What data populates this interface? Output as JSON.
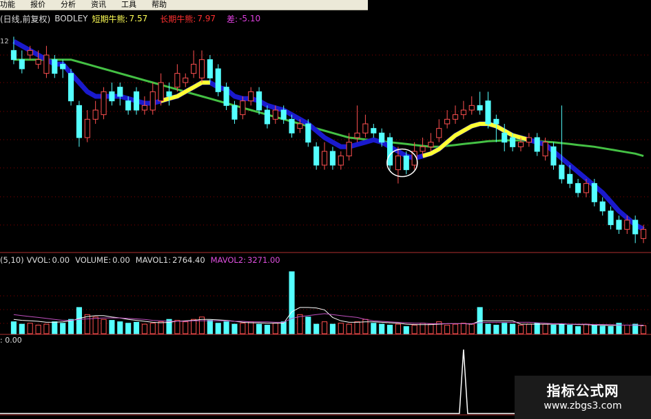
{
  "menu": [
    "功能",
    "报价",
    "分析",
    "资讯",
    "工具",
    "帮助"
  ],
  "main_header": {
    "period": "(日线,前复权)",
    "indicator": "BODLEY",
    "short_label": "短期牛熊:",
    "short_value": "7.57",
    "long_label": "长期牛熊:",
    "long_value": "7.97",
    "diff_label": "差:",
    "diff_value": "-5.10",
    "left_label": "12"
  },
  "volume_header": {
    "name": "(5,10)",
    "vvol_label": "VVOL:",
    "vvol_value": "0.00",
    "volume_label": "VOLUME:",
    "volume_value": "0.00",
    "mavol1_label": "MAVOL1:",
    "mavol1_value": "2764.40",
    "mavol2_label": "MAVOL2:",
    "mavol2_value": "3271.00"
  },
  "indicator_header": {
    "value": ": 0.00"
  },
  "colors": {
    "up": "#ff5050",
    "down": "#54ffff",
    "short_line": "#1a1acd",
    "long_line": "#44c044",
    "highlight": "#ffff33",
    "mavol1": "#ffffff",
    "mavol2": "#c050c0",
    "grid": "#8b0000"
  },
  "watermark": {
    "title": "指标公式网",
    "url": "www.zbgs3.com"
  },
  "chart_data": {
    "type": "candlestick",
    "open": [
      9.8,
      9.6,
      9.7,
      9.5,
      9.3,
      9.6,
      9.5,
      9.3,
      8.6,
      7.9,
      8.3,
      8.4,
      8.9,
      9.0,
      8.7,
      8.9,
      8.5,
      8.5,
      8.7,
      8.9,
      9.0,
      9.1,
      9.3,
      9.2,
      9.6,
      9.4,
      9.0,
      8.6,
      8.4,
      8.7,
      8.9,
      8.5,
      8.3,
      8.5,
      8.3,
      8.1,
      8.2,
      7.7,
      7.3,
      7.6,
      7.3,
      7.5,
      7.9,
      8.0,
      8.1,
      8.0,
      7.9,
      7.2,
      7.5,
      7.3,
      7.6,
      7.7,
      7.9,
      8.2,
      8.3,
      8.4,
      8.5,
      8.6,
      8.7,
      8.3,
      8.0,
      7.9,
      7.7,
      7.8,
      7.9,
      7.5,
      7.7,
      7.3,
      7.1,
      6.9,
      6.7,
      6.9,
      6.5,
      6.3,
      6.1,
      5.9,
      6.1,
      5.7
    ],
    "close": [
      9.6,
      9.4,
      9.8,
      9.6,
      9.7,
      9.3,
      9.4,
      8.7,
      7.9,
      8.3,
      8.5,
      8.9,
      8.7,
      8.8,
      8.5,
      8.5,
      8.6,
      8.9,
      9.1,
      8.8,
      9.3,
      9.2,
      9.5,
      9.6,
      9.2,
      8.9,
      8.6,
      8.3,
      8.7,
      8.9,
      8.5,
      8.2,
      8.5,
      8.3,
      8.0,
      8.2,
      7.8,
      7.3,
      7.6,
      7.3,
      7.5,
      7.8,
      8.0,
      8.2,
      8.0,
      7.8,
      7.3,
      7.5,
      7.2,
      7.6,
      7.7,
      7.8,
      8.1,
      8.3,
      8.4,
      8.5,
      8.6,
      8.5,
      8.2,
      8.2,
      7.8,
      7.7,
      7.8,
      7.9,
      7.6,
      7.8,
      7.3,
      7.0,
      6.9,
      6.7,
      6.9,
      6.5,
      6.3,
      6.0,
      5.9,
      6.1,
      5.8,
      5.9
    ],
    "high": [
      10.1,
      9.8,
      9.9,
      9.8,
      9.9,
      9.7,
      9.6,
      9.4,
      8.7,
      8.5,
      8.7,
      9.0,
      9.1,
      9.1,
      8.8,
      9.0,
      8.8,
      9.1,
      9.3,
      9.1,
      9.5,
      9.3,
      9.8,
      9.8,
      9.7,
      9.5,
      9.1,
      8.7,
      8.8,
      9.0,
      9.0,
      8.6,
      8.6,
      8.6,
      8.4,
      8.3,
      8.3,
      7.8,
      7.8,
      7.7,
      7.6,
      8.0,
      8.6,
      8.4,
      8.2,
      8.1,
      8.0,
      7.7,
      7.6,
      7.8,
      7.9,
      8.0,
      8.3,
      8.5,
      8.6,
      8.7,
      8.8,
      8.9,
      8.9,
      8.4,
      8.2,
      8.0,
      7.9,
      8.0,
      8.0,
      7.9,
      7.8,
      8.6,
      7.3,
      7.0,
      7.0,
      7.0,
      6.6,
      6.4,
      6.2,
      6.2,
      6.2,
      6.0
    ],
    "low": [
      9.5,
      9.3,
      9.6,
      9.4,
      9.2,
      9.2,
      9.2,
      8.6,
      7.7,
      7.8,
      8.2,
      8.3,
      8.6,
      8.6,
      8.4,
      8.4,
      8.4,
      8.4,
      8.6,
      8.6,
      8.9,
      9.0,
      9.2,
      9.1,
      9.1,
      8.8,
      8.5,
      8.2,
      8.3,
      8.6,
      8.4,
      8.1,
      8.2,
      8.2,
      7.9,
      8.0,
      7.7,
      7.2,
      7.2,
      7.2,
      7.2,
      7.4,
      7.8,
      7.9,
      7.9,
      7.7,
      7.2,
      6.9,
      7.1,
      7.2,
      7.5,
      7.6,
      7.8,
      8.1,
      8.2,
      8.3,
      8.4,
      8.4,
      8.1,
      7.8,
      7.6,
      7.6,
      7.6,
      7.7,
      7.5,
      7.4,
      7.2,
      6.9,
      6.8,
      6.6,
      6.6,
      6.4,
      6.2,
      5.9,
      5.8,
      5.8,
      5.6,
      5.6
    ],
    "short_line": [
      10.0,
      9.9,
      9.8,
      9.7,
      9.6,
      9.5,
      9.5,
      9.3,
      9.1,
      8.9,
      8.8,
      8.8,
      8.8,
      8.8,
      8.75,
      8.7,
      8.65,
      8.65,
      8.7,
      8.75,
      8.8,
      8.9,
      9.0,
      9.1,
      9.1,
      9.0,
      8.95,
      8.8,
      8.75,
      8.75,
      8.7,
      8.6,
      8.55,
      8.5,
      8.4,
      8.3,
      8.2,
      8.05,
      7.9,
      7.8,
      7.7,
      7.7,
      7.75,
      7.8,
      7.85,
      7.8,
      7.7,
      7.6,
      7.5,
      7.45,
      7.5,
      7.55,
      7.65,
      7.8,
      7.95,
      8.05,
      8.15,
      8.2,
      8.2,
      8.15,
      8.05,
      7.95,
      7.9,
      7.85,
      7.8,
      7.75,
      7.6,
      7.45,
      7.3,
      7.15,
      7.0,
      6.85,
      6.7,
      6.5,
      6.3,
      6.15,
      6.0,
      5.9
    ],
    "long_line": [
      9.6,
      9.6,
      9.6,
      9.6,
      9.6,
      9.6,
      9.6,
      9.6,
      9.55,
      9.5,
      9.45,
      9.4,
      9.35,
      9.3,
      9.25,
      9.2,
      9.15,
      9.1,
      9.05,
      9.0,
      8.95,
      8.9,
      8.85,
      8.8,
      8.75,
      8.7,
      8.65,
      8.6,
      8.55,
      8.5,
      8.45,
      8.4,
      8.35,
      8.3,
      8.25,
      8.2,
      8.15,
      8.1,
      8.05,
      8.0,
      7.95,
      7.9,
      7.88,
      7.86,
      7.84,
      7.82,
      7.8,
      7.78,
      7.76,
      7.74,
      7.72,
      7.7,
      7.7,
      7.72,
      7.74,
      7.76,
      7.78,
      7.8,
      7.82,
      7.83,
      7.84,
      7.84,
      7.84,
      7.83,
      7.82,
      7.81,
      7.8,
      7.78,
      7.76,
      7.74,
      7.72,
      7.7,
      7.67,
      7.64,
      7.61,
      7.58,
      7.55,
      7.5
    ],
    "highlight_ranges": [
      [
        18,
        24
      ],
      [
        50,
        63
      ]
    ],
    "volume": [
      25,
      20,
      22,
      18,
      20,
      25,
      22,
      30,
      55,
      40,
      35,
      30,
      28,
      25,
      22,
      24,
      20,
      22,
      25,
      30,
      28,
      25,
      30,
      35,
      28,
      22,
      25,
      20,
      22,
      25,
      20,
      18,
      22,
      25,
      130,
      40,
      35,
      20,
      25,
      20,
      22,
      20,
      25,
      30,
      22,
      20,
      18,
      20,
      15,
      18,
      22,
      20,
      25,
      18,
      20,
      22,
      20,
      55,
      20,
      18,
      22,
      20,
      18,
      20,
      22,
      20,
      18,
      20,
      18,
      15,
      20,
      18,
      16,
      15,
      22,
      18,
      20,
      17
    ],
    "mavol1": [
      30,
      28,
      27,
      26,
      24,
      24,
      25,
      27,
      32,
      36,
      38,
      38,
      35,
      33,
      30,
      28,
      26,
      24,
      23,
      24,
      26,
      27,
      28,
      30,
      30,
      29,
      28,
      26,
      24,
      23,
      23,
      22,
      22,
      22,
      46,
      55,
      55,
      54,
      50,
      34,
      27,
      24,
      24,
      25,
      25,
      24,
      23,
      22,
      20,
      19,
      19,
      19,
      20,
      21,
      21,
      21,
      20,
      27,
      27,
      27,
      27,
      27,
      20,
      20,
      20,
      20,
      20,
      20,
      20,
      19,
      19,
      18,
      18,
      17,
      18,
      18,
      18,
      17
    ],
    "mavol2": [
      40,
      38,
      36,
      34,
      32,
      30,
      28,
      28,
      30,
      31,
      32,
      33,
      33,
      33,
      32,
      31,
      30,
      28,
      27,
      26,
      26,
      26,
      27,
      27,
      27,
      27,
      27,
      26,
      26,
      25,
      25,
      25,
      24,
      24,
      32,
      36,
      38,
      40,
      42,
      40,
      38,
      36,
      34,
      30,
      27,
      26,
      25,
      24,
      23,
      22,
      22,
      21,
      21,
      21,
      21,
      21,
      21,
      23,
      24,
      24,
      24,
      24,
      24,
      24,
      23,
      22,
      21,
      21,
      20,
      20,
      20,
      19,
      19,
      19,
      18,
      18,
      18,
      18
    ],
    "indicator_spike_index": 55,
    "ylim_main": [
      5.5,
      10.3
    ],
    "ylim_volume": [
      0,
      140
    ]
  }
}
